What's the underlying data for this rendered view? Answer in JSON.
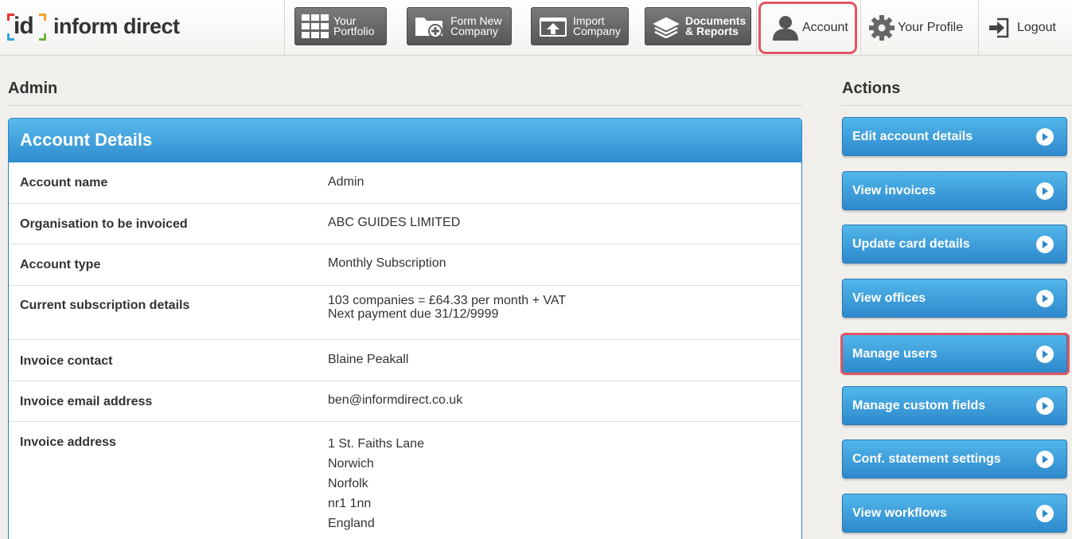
{
  "brand": {
    "mark": "id",
    "name": "inform direct"
  },
  "nav": {
    "portfolio": "Your\nPortfolio",
    "form_new": "Form New\nCompany",
    "import": "Import\nCompany",
    "documents": "Documents\n& Reports",
    "account": "Account",
    "profile": "Your Profile",
    "logout": "Logout"
  },
  "page": {
    "title": "Admin"
  },
  "account_details": {
    "heading": "Account Details",
    "rows": [
      {
        "label": "Account name",
        "values": [
          "Admin"
        ]
      },
      {
        "label": "Organisation to be invoiced",
        "values": [
          "ABC GUIDES LIMITED"
        ]
      },
      {
        "label": "Account type",
        "values": [
          "Monthly Subscription"
        ]
      },
      {
        "label": "Current subscription details",
        "values": [
          "103 companies = £64.33 per month + VAT",
          "Next payment due 31/12/9999"
        ]
      },
      {
        "label": "Invoice contact",
        "values": [
          "Blaine Peakall"
        ]
      },
      {
        "label": "Invoice email address",
        "values": [
          "ben@informdirect.co.uk"
        ]
      },
      {
        "label": "Invoice address",
        "values": [
          "1 St. Faiths Lane",
          "Norwich",
          "Norfolk",
          "nr1 1nn",
          "England"
        ]
      }
    ]
  },
  "actions": {
    "title": "Actions",
    "items": [
      "Edit account details",
      "View invoices",
      "Update card details",
      "View offices",
      "Manage users",
      "Manage custom fields",
      "Conf. statement settings",
      "View workflows"
    ]
  },
  "colors": {
    "accent_blue": "#2f8ccf",
    "highlight_red": "#e05562",
    "nav_gray": "#656565"
  }
}
